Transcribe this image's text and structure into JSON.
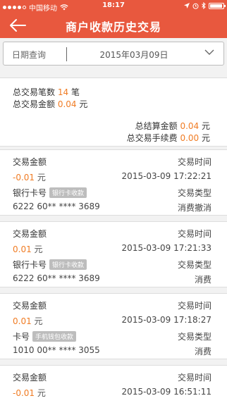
{
  "status_bar": {
    "carrier": "中国移动",
    "time": "18:17",
    "signal_bars": 4,
    "signal_total": 5,
    "battery_level": 0.95
  },
  "header": {
    "title": "商户收款历史交易",
    "back_icon": "arrow-left-icon"
  },
  "date_filter": {
    "label": "日期查询",
    "value": "2015年03月09日",
    "icon": "chevron-down-icon"
  },
  "summary": {
    "count_label": "总交易笔数",
    "count_value": "14",
    "count_unit": "笔",
    "amount_label": "总交易金额",
    "amount_value": "0.04",
    "amount_unit": "元",
    "settle_label": "总结算金额",
    "settle_value": "0.04",
    "settle_unit": "元",
    "fee_label": "总交易手续费",
    "fee_value": "0.00",
    "fee_unit": "元"
  },
  "transactions": [
    {
      "amount_label": "交易金额",
      "time_label": "交易时间",
      "amount": "-0.01",
      "unit": "元",
      "time": "2015-03-09 17:22:21",
      "card_label": "银行卡号",
      "tag": "银行卡收款",
      "type_label": "交易类型",
      "card_no": "6222 60** **** 3689",
      "type": "消费撤消"
    },
    {
      "amount_label": "交易金额",
      "time_label": "交易时间",
      "amount": "0.01",
      "unit": "元",
      "time": "2015-03-09 17:21:33",
      "card_label": "银行卡号",
      "tag": "银行卡收款",
      "type_label": "交易类型",
      "card_no": "6222 60** **** 3689",
      "type": "消费"
    },
    {
      "amount_label": "交易金额",
      "time_label": "交易时间",
      "amount": "0.01",
      "unit": "元",
      "time": "2015-03-09 17:18:27",
      "card_label": "卡号",
      "tag": "手机钱包收款",
      "type_label": "交易类型",
      "card_no": "1010 00** **** 3055",
      "type": "消费"
    },
    {
      "amount_label": "交易金额",
      "time_label": "交易时间",
      "amount": "-0.01",
      "unit": "元",
      "time": "2015-03-09 16:51:11"
    }
  ],
  "colors": {
    "brand": "#e8583e",
    "accent": "#f07c24",
    "tag_bg": "#bdbdbd"
  }
}
